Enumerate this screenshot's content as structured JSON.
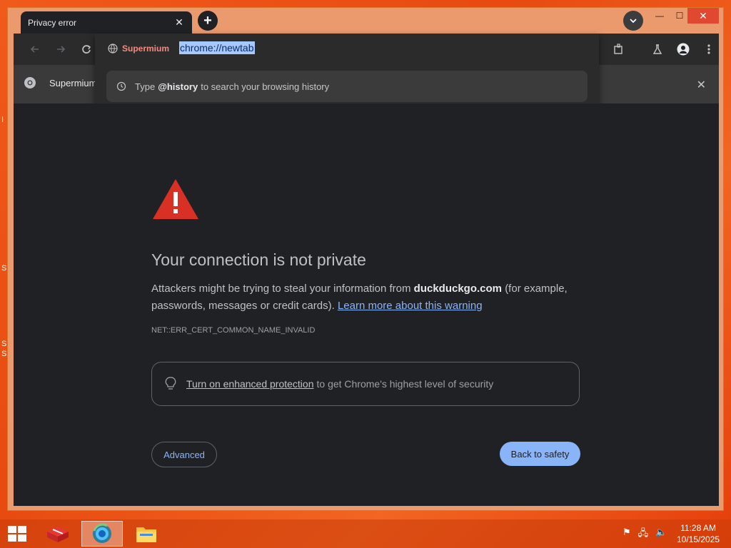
{
  "browser": {
    "tab": {
      "title": "Privacy error",
      "close_icon": "close-icon"
    },
    "omnibox": {
      "site_label": "Supermium",
      "url": "chrome://newtab"
    },
    "suggestion": {
      "prefix": "Type",
      "keyword": "@history",
      "suffix": "to search your browsing history"
    },
    "bookmark": {
      "label": "Supermium"
    }
  },
  "page": {
    "title": "Your connection is not private",
    "body_text_1": "Attackers might be trying to steal your information from",
    "domain": "duckduckgo.com",
    "body_text_2": "(for example, passwords, messages or credit cards).",
    "learn_more": "Learn more about this warning",
    "error_code": "NET::ERR_CERT_COMMON_NAME_INVALID",
    "protection_link": "Turn on enhanced protection",
    "protection_text": "to get Chrome's highest level of security",
    "advanced_button": "Advanced",
    "back_button": "Back to safety"
  },
  "taskbar": {
    "time": "11:28 AM",
    "date": "10/15/2025"
  },
  "desktop": {
    "edge_text": [
      "I",
      "S",
      "S",
      "S"
    ]
  },
  "colors": {
    "accent": "#8ab4f8",
    "warning": "#d93025",
    "background": "#202124"
  }
}
